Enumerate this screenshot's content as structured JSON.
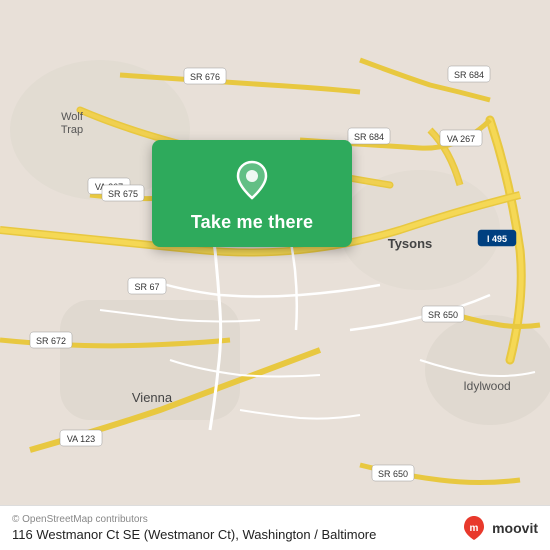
{
  "map": {
    "background_color": "#e8e0d8"
  },
  "card": {
    "button_label": "Take me there",
    "background_color": "#2eaa5c"
  },
  "bottom_bar": {
    "attribution": "© OpenStreetMap contributors",
    "address": "116 Westmanor Ct SE (Westmanor Ct), Washington / Baltimore"
  },
  "moovit": {
    "logo_text": "moovit"
  },
  "labels": {
    "wolf_trap": "Wolf\nTrap",
    "tysons": "Tysons",
    "vienna": "Vienna",
    "idylwood": "Idylwood",
    "sr_676": "SR 676",
    "sr_684_top": "SR 684",
    "sr_684_mid": "SR 684",
    "sr_675": "SR 675",
    "sr_67": "SR 67",
    "sr_650_right": "SR 650",
    "sr_650_bottom": "SR 650",
    "sr_672": "SR 672",
    "va_267_left": "VA 267",
    "va_267_right": "VA 267",
    "va_123": "VA 123",
    "i_495": "I 495"
  }
}
